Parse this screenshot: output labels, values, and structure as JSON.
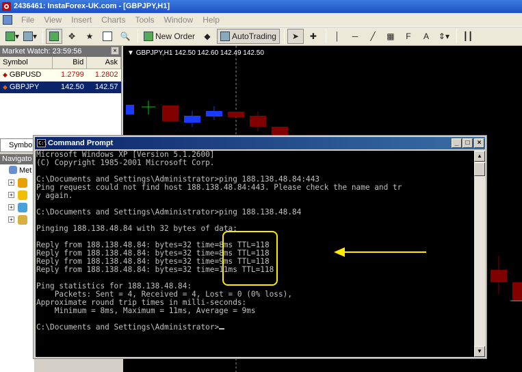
{
  "window": {
    "title": "2436461: InstaForex-UK.com - [GBPJPY,H1]"
  },
  "menu": [
    "File",
    "View",
    "Insert",
    "Charts",
    "Tools",
    "Window",
    "Help"
  ],
  "toolbar": {
    "new_order": "New Order",
    "auto_trading": "AutoTrading",
    "text_tool": "A"
  },
  "market_watch": {
    "title": "Market Watch: 23:59:56",
    "columns": [
      "Symbol",
      "Bid",
      "Ask"
    ],
    "rows": [
      {
        "symbol": "GBPUSD",
        "bid": "1.2799",
        "ask": "1.2802"
      },
      {
        "symbol": "GBPJPY",
        "bid": "142.50",
        "ask": "142.57"
      }
    ],
    "tab": "Symbo"
  },
  "navigator": {
    "title": "Navigato",
    "items": [
      "Met"
    ]
  },
  "chart": {
    "label": "GBPJPY,H1  142.50  142.60  142.49  142.50"
  },
  "cmd": {
    "title": "Command Prompt",
    "lines": [
      "Microsoft Windows XP [Version 5.1.2600]",
      "(C) Copyright 1985-2001 Microsoft Corp.",
      "",
      "C:\\Documents and Settings\\Administrator>ping 188.138.48.84:443",
      "Ping request could not find host 188.138.48.84:443. Please check the name and tr",
      "y again.",
      "",
      "C:\\Documents and Settings\\Administrator>ping 188.138.48.84",
      "",
      "Pinging 188.138.48.84 with 32 bytes of data:",
      "",
      "Reply from 188.138.48.84: bytes=32 time=8ms TTL=118",
      "Reply from 188.138.48.84: bytes=32 time=8ms TTL=118",
      "Reply from 188.138.48.84: bytes=32 time=9ms TTL=118",
      "Reply from 188.138.48.84: bytes=32 time=11ms TTL=118",
      "",
      "Ping statistics for 188.138.48.84:",
      "    Packets: Sent = 4, Received = 4, Lost = 0 (0% loss),",
      "Approximate round trip times in milli-seconds:",
      "    Minimum = 8ms, Maximum = 11ms, Average = 9ms",
      "",
      "C:\\Documents and Settings\\Administrator>"
    ]
  },
  "colors": {
    "bid_up": "#cc0000",
    "selected_row": "#0a246a",
    "highlight": "#ffea00"
  }
}
